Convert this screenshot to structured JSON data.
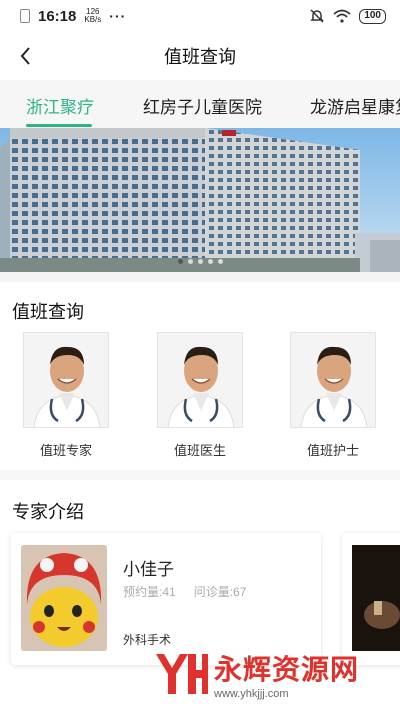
{
  "status_bar": {
    "time": "16:18",
    "net_speed_value": "126",
    "net_speed_unit": "KB/s",
    "more": "···",
    "battery": "100"
  },
  "header": {
    "title": "值班查询"
  },
  "tabs": [
    "浙江聚疗",
    "红房子儿童医院",
    "龙游启星康复"
  ],
  "banner": {
    "dot_count": 5,
    "active_dot": 1
  },
  "duty_section": {
    "title": "值班查询",
    "items": [
      {
        "label": "值班专家"
      },
      {
        "label": "值班医生"
      },
      {
        "label": "值班护士"
      }
    ]
  },
  "expert_section": {
    "title": "专家介绍",
    "cards": [
      {
        "name": "小佳子",
        "appointments": "预约量:41",
        "consultations": "问诊量:67",
        "department": "外科手术"
      }
    ]
  },
  "watermark": {
    "brand": "永辉资源网",
    "url": "www.yhkjjj.com"
  },
  "colors": {
    "accent": "#2bb487",
    "watermark": "#e0312c"
  }
}
